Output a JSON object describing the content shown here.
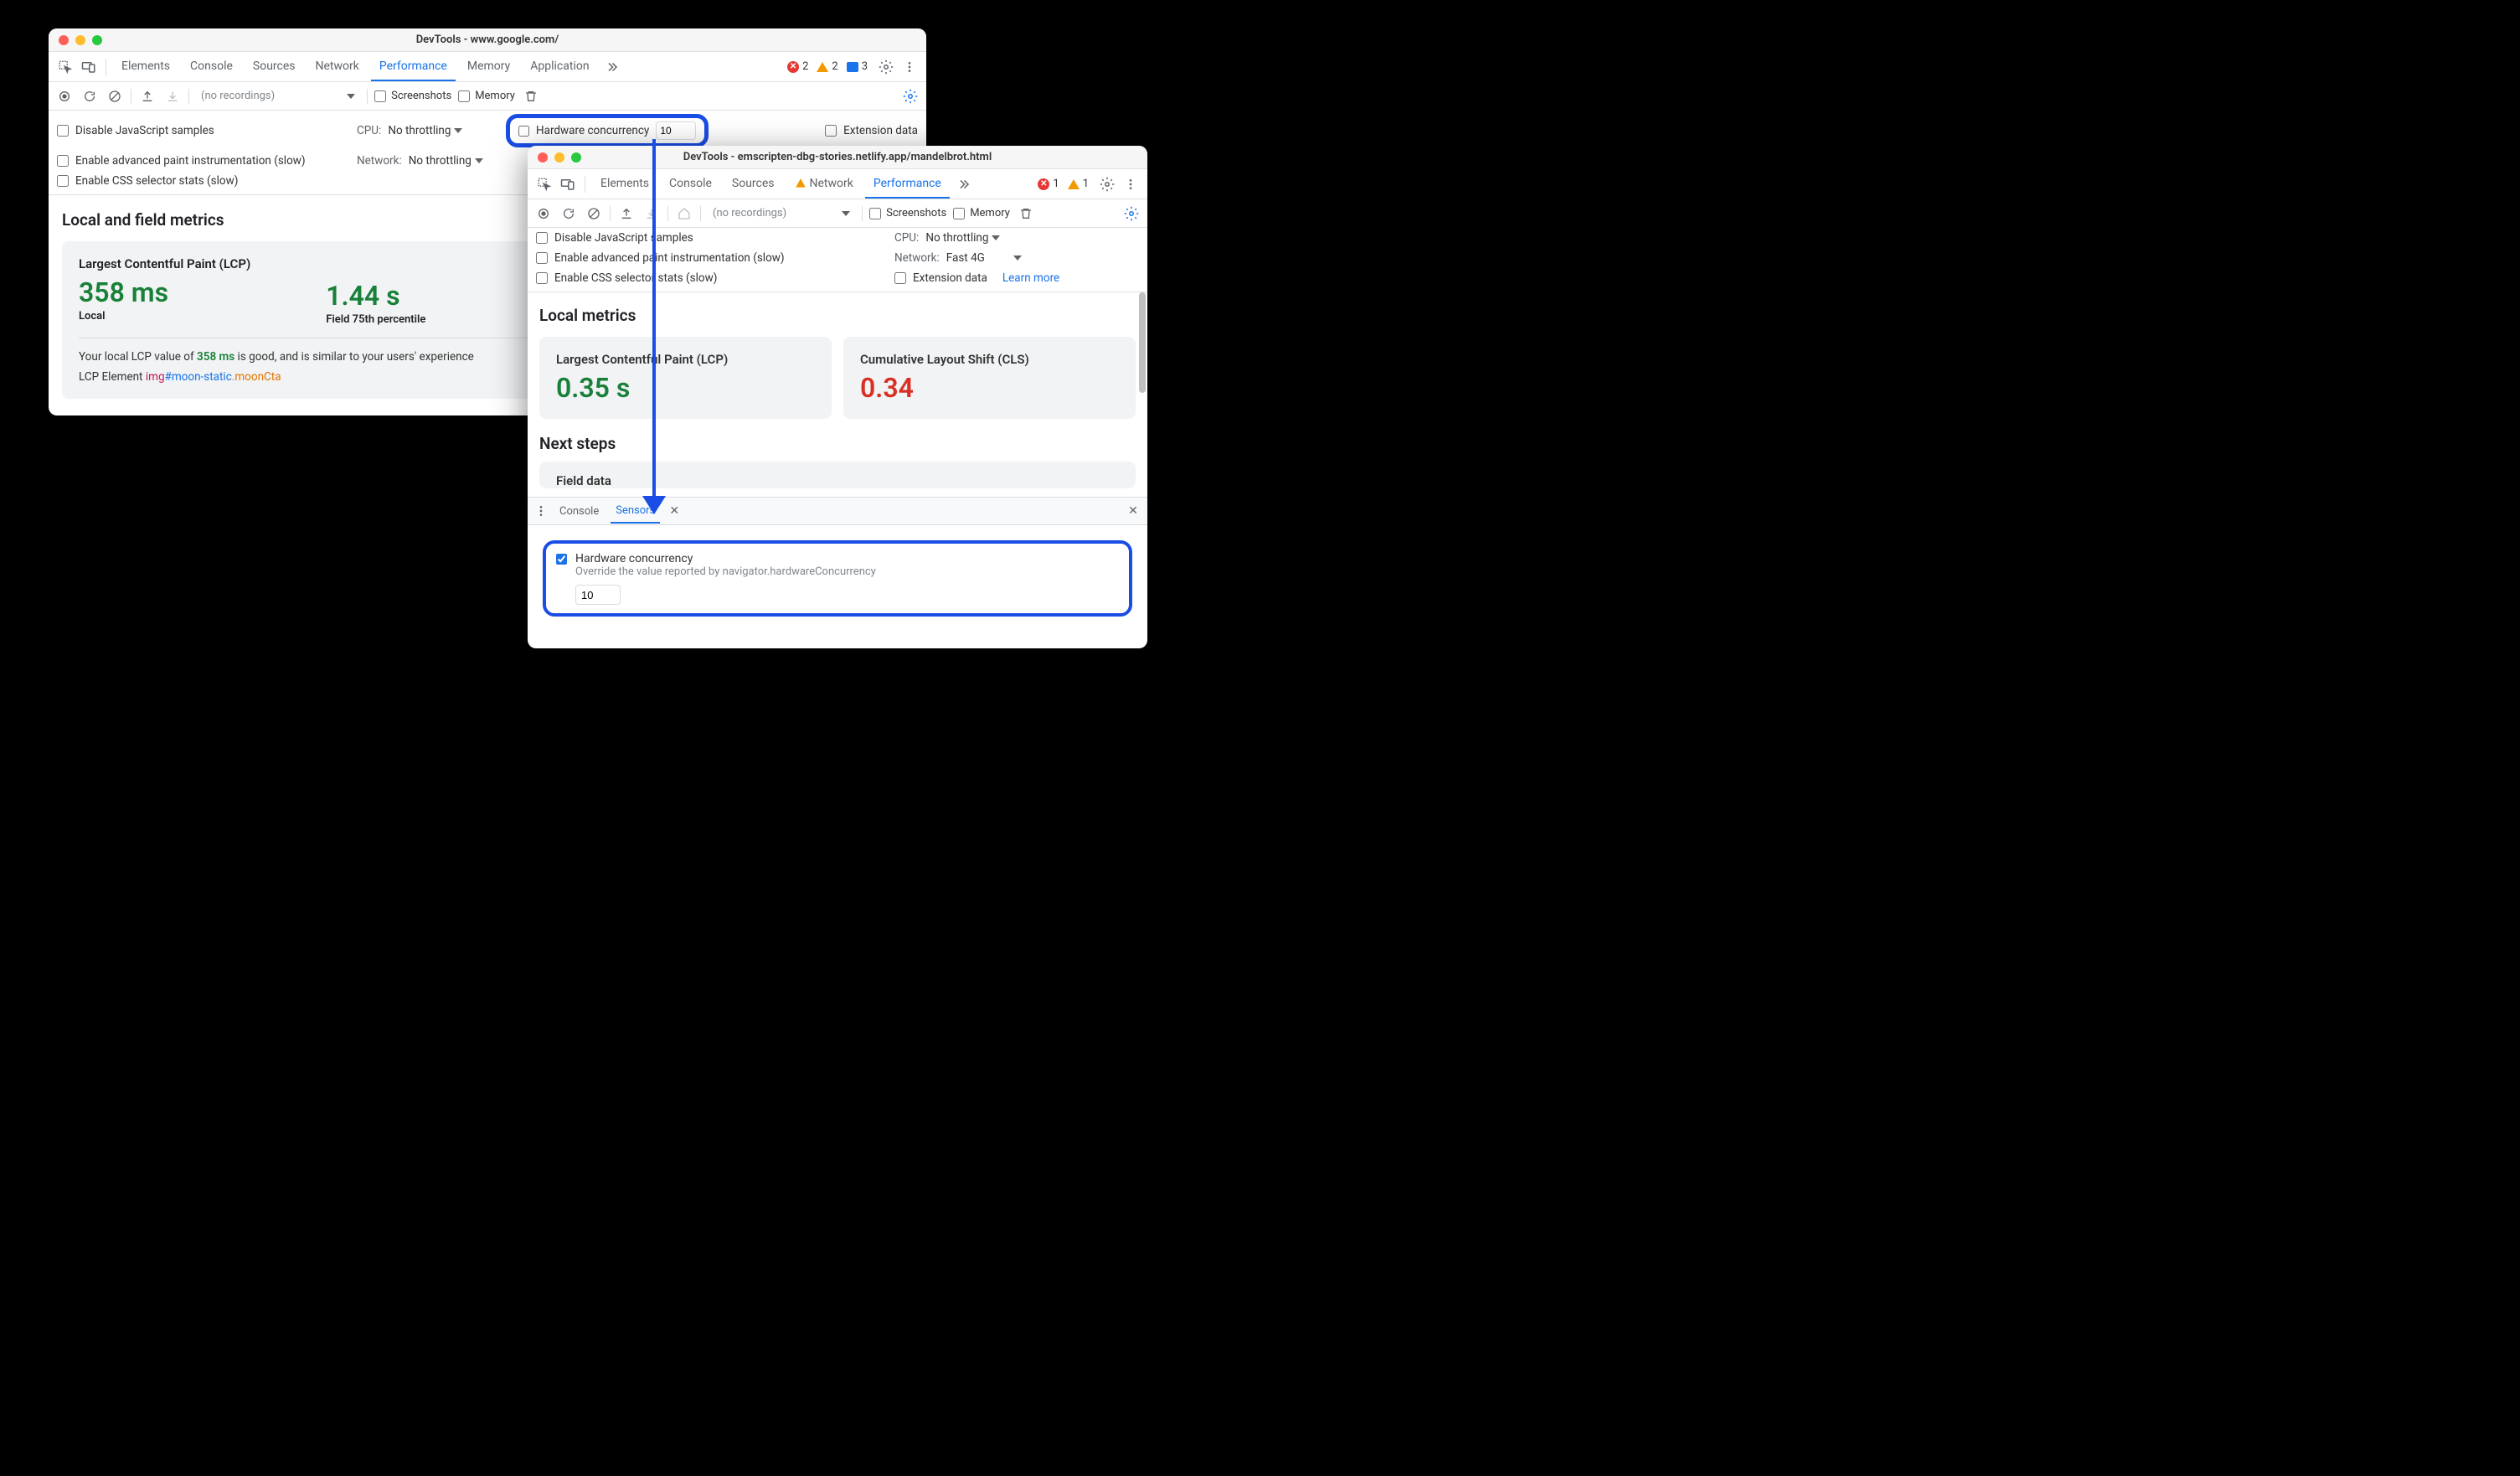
{
  "w1": {
    "title": "DevTools - www.google.com/",
    "tabs": [
      "Elements",
      "Console",
      "Sources",
      "Network",
      "Performance",
      "Memory",
      "Application"
    ],
    "active_tab": "Performance",
    "badges": {
      "errors": "2",
      "warnings": "2",
      "info": "3"
    },
    "toolbar": {
      "no_recordings": "(no recordings)",
      "screenshots": "Screenshots",
      "memory": "Memory"
    },
    "settings": {
      "disable_js": "Disable JavaScript samples",
      "cpu_label": "CPU:",
      "cpu_value": "No throttling",
      "hw_label": "Hardware concurrency",
      "hw_value": "10",
      "ext_data": "Extension data",
      "advanced_paint": "Enable advanced paint instrumentation (slow)",
      "network_label": "Network:",
      "network_value": "No throttling",
      "css_stats": "Enable CSS selector stats (slow)"
    },
    "metrics": {
      "heading": "Local and field metrics",
      "lcp_title": "Largest Contentful Paint (LCP)",
      "lcp_local": "358 ms",
      "lcp_local_sub": "Local",
      "lcp_field": "1.44 s",
      "lcp_field_sub": "Field 75th percentile",
      "note_pre": "Your local LCP value of ",
      "note_val": "358 ms",
      "note_post": " is good, and is similar to your users' experience",
      "lcp_el_label": "LCP Element  ",
      "lcp_el_img": "img",
      "lcp_el_id": "#moon-static",
      "lcp_el_cls": ".moonCta"
    }
  },
  "w2": {
    "title": "DevTools - emscripten-dbg-stories.netlify.app/mandelbrot.html",
    "tabs": [
      "Elements",
      "Console",
      "Sources",
      "Network",
      "Performance"
    ],
    "active_tab": "Performance",
    "network_warn": true,
    "badges": {
      "errors": "1",
      "warnings": "1"
    },
    "toolbar": {
      "no_recordings": "(no recordings)",
      "screenshots": "Screenshots",
      "memory": "Memory"
    },
    "settings": {
      "disable_js": "Disable JavaScript samples",
      "cpu_label": "CPU:",
      "cpu_value": "No throttling",
      "advanced_paint": "Enable advanced paint instrumentation (slow)",
      "network_label": "Network:",
      "network_value": "Fast 4G",
      "css_stats": "Enable CSS selector stats (slow)",
      "ext_data": "Extension data",
      "learn_more": "Learn more"
    },
    "metrics": {
      "heading": "Local metrics",
      "lcp_title": "Largest Contentful Paint (LCP)",
      "lcp_val": "0.35 s",
      "cls_title": "Cumulative Layout Shift (CLS)",
      "cls_val": "0.34",
      "next_steps": "Next steps",
      "field_data": "Field data"
    },
    "drawer": {
      "tabs": [
        "Console",
        "Sensors"
      ],
      "active": "Sensors",
      "hc_label": "Hardware concurrency",
      "hc_desc": "Override the value reported by navigator.hardwareConcurrency",
      "hc_value": "10"
    }
  }
}
